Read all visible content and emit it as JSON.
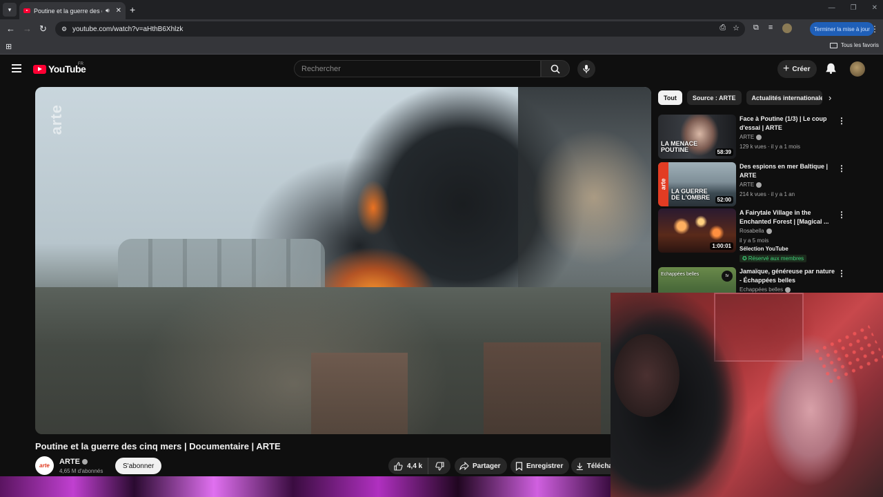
{
  "browser": {
    "tab_title": "Poutine et la guerre des cinq mers | Documentaire | ARTE",
    "audio_icon": "speaker-icon",
    "url": "youtube.com/watch?v=aHthB6Xhlzk",
    "update_label": "Terminer la mise à jour",
    "all_bookmarks_label": "Tous les favoris"
  },
  "youtube": {
    "logo_text": "YouTube",
    "country_code": "FR",
    "search_placeholder": "Rechercher",
    "create_label": "Créer"
  },
  "video": {
    "watermark": "arte",
    "title": "Poutine et la guerre des cinq mers | Documentaire | ARTE",
    "channel_name": "ARTE",
    "channel_avatar_text": "arte",
    "subscribers": "4,65 M d'abonnés",
    "subscribe_label": "S'abonner",
    "likes": "4,4 k",
    "share_label": "Partager",
    "save_label": "Enregistrer",
    "download_label": "Télécha"
  },
  "sidebar": {
    "chips": [
      "Tout",
      "Source : ARTE",
      "Actualités internationales"
    ],
    "recommendations": [
      {
        "title": "Face à Poutine (1/3) | Le coup d'essai | ARTE",
        "channel": "ARTE",
        "verified": true,
        "meta": "129 k vues · il y a 1 mois",
        "duration": "58:39",
        "thumb_label": "LA MENACE\nPOUTINE"
      },
      {
        "title": "Des espions en mer Baltique | ARTE",
        "channel": "ARTE",
        "verified": true,
        "meta": "214 k vues · il y a 1 an",
        "duration": "52:00",
        "thumb_label": "LA GUERRE\nDE L'OMBRE",
        "thumb_side": "arte"
      },
      {
        "title": "A Fairytale Village in the Enchanted Forest | [Magical ...",
        "channel": "Rosabella",
        "verified": true,
        "meta": "il y a 5 mois",
        "badge": "Sélection YouTube",
        "member_badge": "Réservé aux membres",
        "duration": "1:00:01"
      },
      {
        "title": "Jamaïque, généreuse par nature - Échappées belles",
        "channel": "Echappées belles",
        "verified": true,
        "thumb_label": "Echappées belles",
        "thumb_corner": "tv"
      }
    ]
  },
  "colors": {
    "yt_red": "#ff0033",
    "bg": "#0f0f0f",
    "chip_bg": "#272727",
    "member_green": "#3fd27a"
  }
}
